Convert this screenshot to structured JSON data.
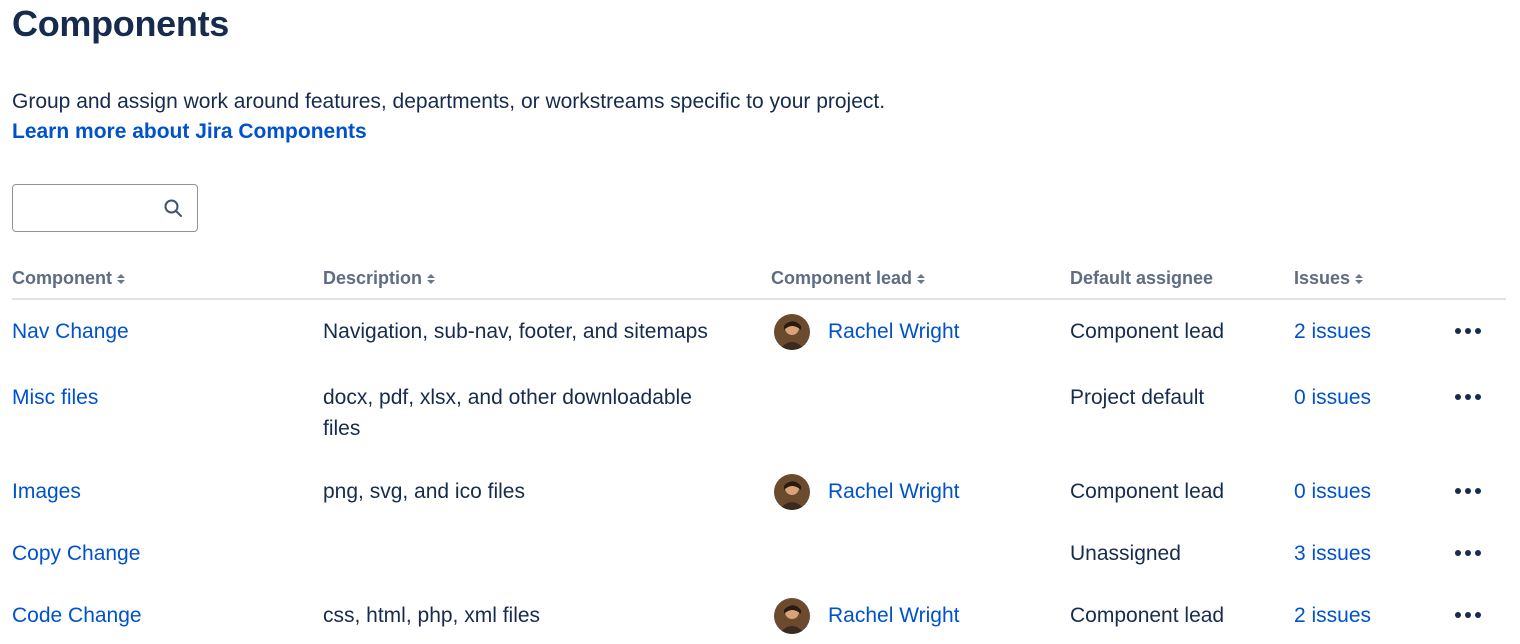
{
  "page": {
    "title": "Components",
    "description": "Group and assign work around features, departments, or workstreams specific to your project.",
    "learn_more": "Learn more about Jira Components"
  },
  "search": {
    "placeholder": "",
    "value": "",
    "icon": "search-icon"
  },
  "table": {
    "headers": {
      "component": "Component",
      "description": "Description",
      "lead": "Component lead",
      "assignee": "Default assignee",
      "issues": "Issues"
    },
    "rows": [
      {
        "component": "Nav Change",
        "description_line1": "Navigation, sub-nav, footer, and sitemaps",
        "description_line2": "",
        "lead": "Rachel Wright",
        "assignee": "Component lead",
        "issues": "2 issues"
      },
      {
        "component": "Misc files",
        "description_line1": "docx, pdf, xlsx, and other downloadable",
        "description_line2": "files",
        "lead": "",
        "assignee": "Project default",
        "issues": "0 issues"
      },
      {
        "component": "Images",
        "description_line1": "png, svg, and ico files",
        "description_line2": "",
        "lead": "Rachel Wright",
        "assignee": "Component lead",
        "issues": "0 issues"
      },
      {
        "component": "Copy Change",
        "description_line1": "",
        "description_line2": "",
        "lead": "",
        "assignee": "Unassigned",
        "issues": "3 issues"
      },
      {
        "component": "Code Change",
        "description_line1": "css, html, php, xml files",
        "description_line2": "",
        "lead": "Rachel Wright",
        "assignee": "Component lead",
        "issues": "2 issues"
      }
    ]
  },
  "colors": {
    "link": "#0052cc",
    "text": "#172b4d",
    "header_text": "#5e6c84",
    "divider": "#dfe1e6"
  }
}
